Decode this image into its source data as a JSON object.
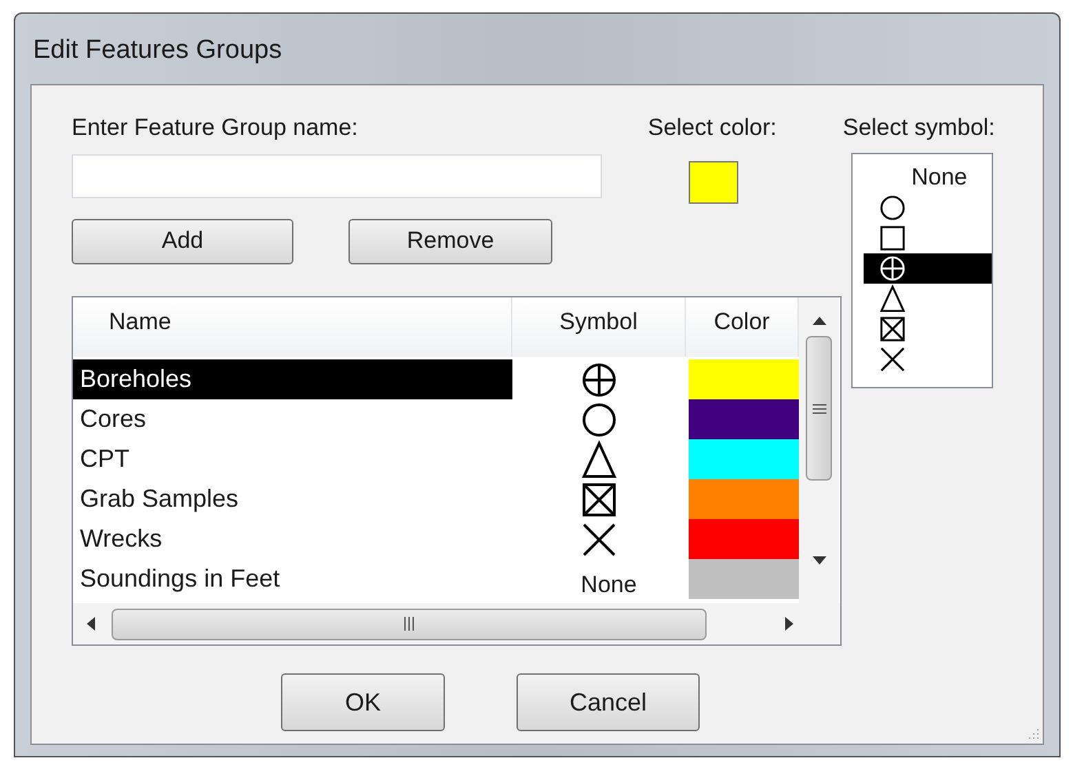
{
  "window": {
    "title": "Edit Features Groups"
  },
  "name_field": {
    "label": "Enter Feature Group name:"
  },
  "color_picker": {
    "label": "Select color:",
    "color": "#ffff00"
  },
  "symbol_picker": {
    "label": "Select symbol:",
    "items": [
      {
        "kind": "none",
        "label": "None",
        "selected": false
      },
      {
        "kind": "circle",
        "selected": false
      },
      {
        "kind": "square",
        "selected": false
      },
      {
        "kind": "crossed-circle",
        "selected": true
      },
      {
        "kind": "triangle",
        "selected": false
      },
      {
        "kind": "crossed-square",
        "selected": false
      },
      {
        "kind": "x",
        "selected": false
      }
    ]
  },
  "buttons": [
    "Add",
    "Remove"
  ],
  "table": {
    "columns": [
      "Name",
      "Symbol",
      "Color"
    ],
    "rows": [
      {
        "name": "Boreholes",
        "symbol": {
          "kind": "crossed-circle"
        },
        "color": "#ffff00",
        "selected": true
      },
      {
        "name": "Cores",
        "symbol": {
          "kind": "circle"
        },
        "color": "#400080",
        "selected": false
      },
      {
        "name": "CPT",
        "symbol": {
          "kind": "triangle"
        },
        "color": "#00ffff",
        "selected": false
      },
      {
        "name": "Grab Samples",
        "symbol": {
          "kind": "crossed-square"
        },
        "color": "#ff8000",
        "selected": false
      },
      {
        "name": "Wrecks",
        "symbol": {
          "kind": "x"
        },
        "color": "#ff0000",
        "selected": false
      },
      {
        "name": "Soundings in Feet",
        "symbol": {
          "kind": "none",
          "label": "None"
        },
        "color": "#c0c0c0",
        "selected": false
      }
    ]
  },
  "dialog_buttons": [
    "OK",
    "Cancel"
  ]
}
